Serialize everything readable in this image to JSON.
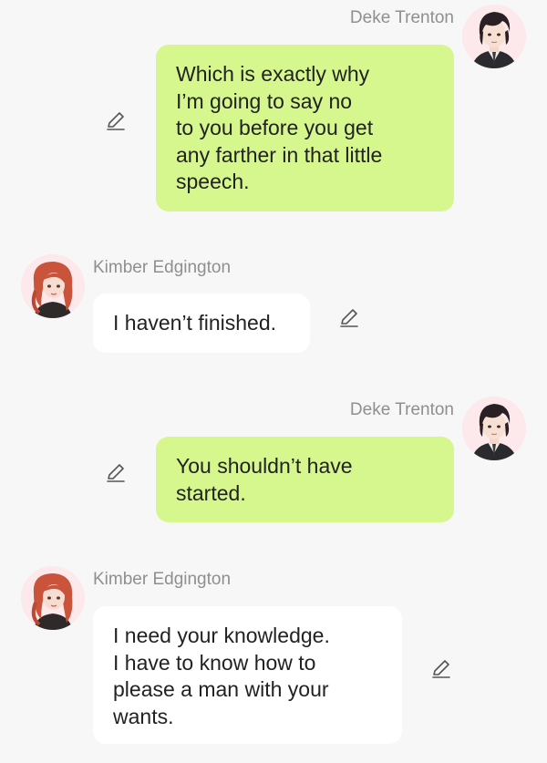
{
  "messages": [
    {
      "sender": "Deke Trenton",
      "side": "right",
      "text": "Which is exactly why\nI’m going to say no\nto you before you get\nany farther in that little\nspeech."
    },
    {
      "sender": "Kimber Edgington",
      "side": "left",
      "text": "I haven’t finished."
    },
    {
      "sender": "Deke Trenton",
      "side": "right",
      "text": "You shouldn’t have\nstarted."
    },
    {
      "sender": "Kimber Edgington",
      "side": "left",
      "text": "I need your knowledge.\nI have to know how to\nplease a man with your\nwants."
    }
  ],
  "colors": {
    "background": "#f7f7f7",
    "outgoing_bubble": "#d6f68e",
    "incoming_bubble": "#ffffff",
    "sender_name": "#8f8f8f"
  },
  "icons": {
    "edit": "pencil-icon",
    "avatar_deke": "deke-avatar",
    "avatar_kimber": "kimber-avatar"
  }
}
